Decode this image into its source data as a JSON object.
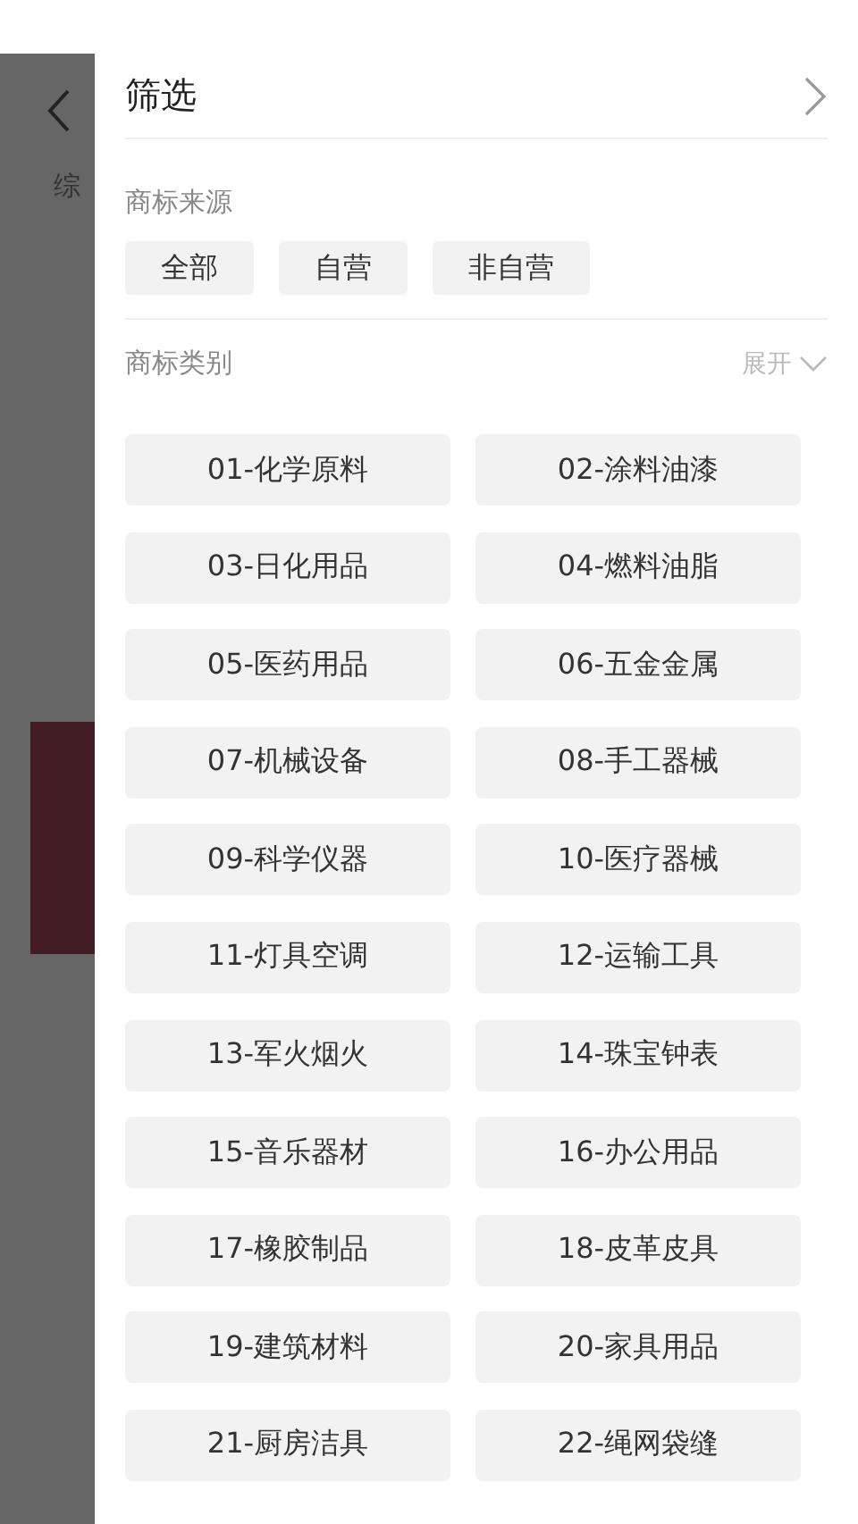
{
  "background_page": {
    "tab_fragment": "综"
  },
  "filter_panel": {
    "title": "筛选",
    "source": {
      "label": "商标来源",
      "options": [
        {
          "label": "全部",
          "selected": false
        },
        {
          "label": "自营",
          "selected": false
        },
        {
          "label": "非自营",
          "selected": false
        }
      ]
    },
    "category": {
      "label": "商标类别",
      "toggle": "展开",
      "expanded": false,
      "options": [
        {
          "label": "01-化学原料",
          "selected": false
        },
        {
          "label": "02-涂料油漆",
          "selected": false
        },
        {
          "label": "03-日化用品",
          "selected": false
        },
        {
          "label": "04-燃料油脂",
          "selected": false
        },
        {
          "label": "05-医药用品",
          "selected": false
        },
        {
          "label": "06-五金金属",
          "selected": false
        },
        {
          "label": "07-机械设备",
          "selected": false
        },
        {
          "label": "08-手工器械",
          "selected": false
        },
        {
          "label": "09-科学仪器",
          "selected": false
        },
        {
          "label": "10-医疗器械",
          "selected": false
        },
        {
          "label": "11-灯具空调",
          "selected": false
        },
        {
          "label": "12-运输工具",
          "selected": false
        },
        {
          "label": "13-军火烟火",
          "selected": false
        },
        {
          "label": "14-珠宝钟表",
          "selected": false
        },
        {
          "label": "15-音乐器材",
          "selected": false
        },
        {
          "label": "16-办公用品",
          "selected": false
        },
        {
          "label": "17-橡胶制品",
          "selected": false
        },
        {
          "label": "18-皮革皮具",
          "selected": false
        },
        {
          "label": "19-建筑材料",
          "selected": false
        },
        {
          "label": "20-家具用品",
          "selected": false
        },
        {
          "label": "21-厨房洁具",
          "selected": false
        },
        {
          "label": "22-绳网袋缝",
          "selected": false
        }
      ]
    }
  }
}
